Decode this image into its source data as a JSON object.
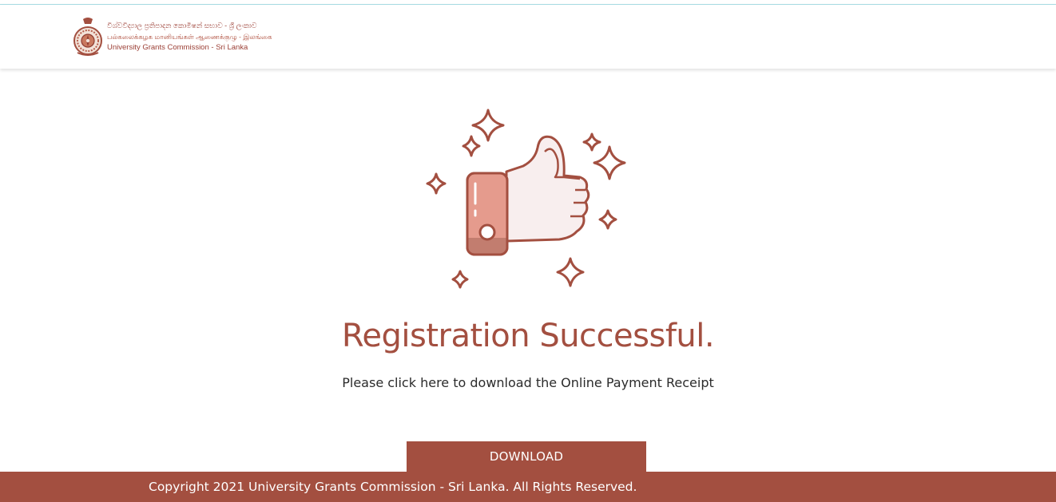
{
  "header": {
    "logo": {
      "line_sinhala": "විශ්වවිද්‍යාල ප්‍රතිපාදන කොමිෂන් සභාව - ශ්‍රී ලංකාව",
      "line_tamil": "பல்கலைக்கழக மானியங்கள் ஆணைக்குழு - இலங்கை",
      "line_english": "University Grants Commission - Sri Lanka"
    }
  },
  "main": {
    "illustration_icon": "thumbs-up-icon",
    "title": "Registration Successful.",
    "message": "Please click here to download the Online Payment Receipt",
    "download_label": "DOWNLOAD"
  },
  "footer": {
    "copyright": "Copyright 2021 University Grants Commission - Sri Lanka. All Rights Reserved."
  },
  "colors": {
    "brand": "#a34f40",
    "thumb_fill": "#f8eeee",
    "cuff_fill": "#e59b8d",
    "top_line": "#a9dde4"
  }
}
